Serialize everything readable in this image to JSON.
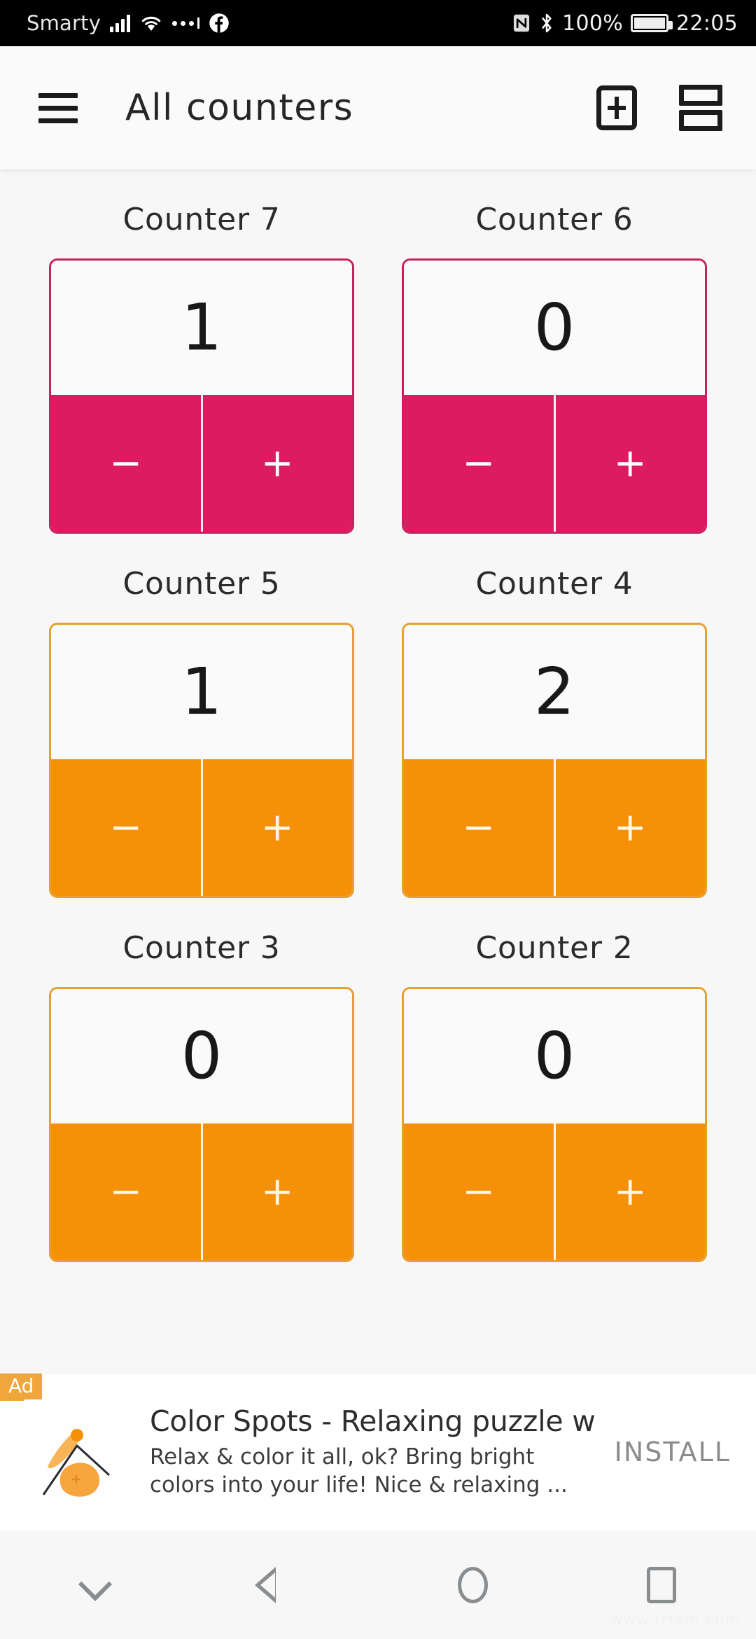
{
  "status_bar": {
    "carrier": "Smarty",
    "battery_percent": "100%",
    "time": "22:05",
    "icons": [
      "signal-icon",
      "wifi-icon",
      "dots-icon",
      "facebook-icon",
      "nfc-icon",
      "bluetooth-icon",
      "battery-icon"
    ]
  },
  "toolbar": {
    "menu_icon": "hamburger-menu-icon",
    "title": "All counters",
    "add_icon": "add-counter-icon",
    "layout_icon": "layout-toggle-icon"
  },
  "counters": [
    {
      "title": "Counter 7",
      "value": "1",
      "decrement": "−",
      "increment": "+",
      "accent": "#DD1B61",
      "border": "#C9215F",
      "theme": "pink"
    },
    {
      "title": "Counter 6",
      "value": "0",
      "decrement": "−",
      "increment": "+",
      "accent": "#DD1B61",
      "border": "#C9215F",
      "theme": "pink"
    },
    {
      "title": "Counter 5",
      "value": "1",
      "decrement": "−",
      "increment": "+",
      "accent": "#F79009",
      "border": "#E5A030",
      "theme": "orange"
    },
    {
      "title": "Counter 4",
      "value": "2",
      "decrement": "−",
      "increment": "+",
      "accent": "#F79009",
      "border": "#E5A030",
      "theme": "orange"
    },
    {
      "title": "Counter 3",
      "value": "0",
      "decrement": "−",
      "increment": "+",
      "accent": "#F79009",
      "border": "#E5A030",
      "theme": "orange"
    },
    {
      "title": "Counter 2",
      "value": "0",
      "decrement": "−",
      "increment": "+",
      "accent": "#F79009",
      "border": "#E5A030",
      "theme": "orange"
    }
  ],
  "ad": {
    "badge": "Ad",
    "title": "Color Spots - Relaxing puzzle with d...",
    "description": "Relax & color it all, ok? Bring bright colors into your life! Nice & relaxing ...",
    "cta": "INSTALL",
    "icon": "color-spots-app-icon",
    "badge_color": "#EFA63B"
  },
  "nav_bar": {
    "buttons": [
      {
        "name": "hide-nav-icon"
      },
      {
        "name": "back-icon"
      },
      {
        "name": "home-icon"
      },
      {
        "name": "recents-icon"
      }
    ]
  },
  "watermark": "www.trfam.com"
}
